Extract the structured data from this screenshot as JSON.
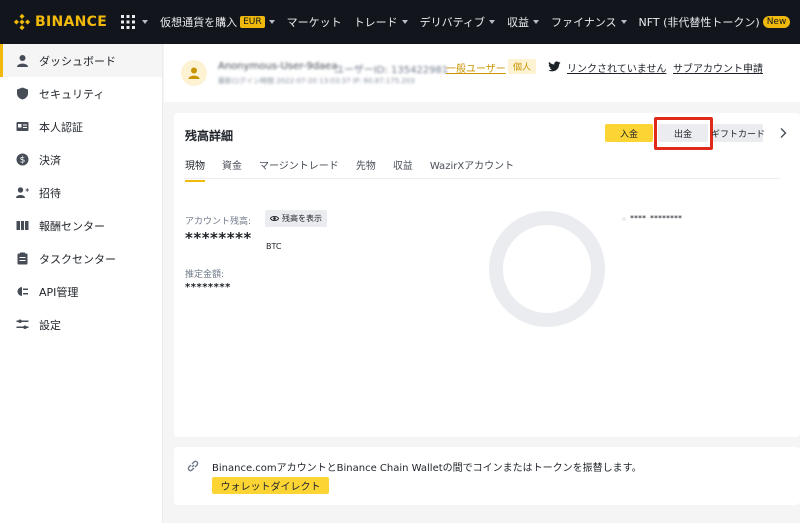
{
  "brand": {
    "name": "BINANCE",
    "color": "#f0b90b"
  },
  "topnav": {
    "items": [
      {
        "label": "仮想通貨を購入",
        "badge": "EUR",
        "has_caret": true
      },
      {
        "label": "マーケット",
        "badge": "",
        "has_caret": false
      },
      {
        "label": "トレード",
        "badge": "",
        "has_caret": true
      },
      {
        "label": "デリバティブ",
        "badge": "",
        "has_caret": true
      },
      {
        "label": "収益",
        "badge": "",
        "has_caret": true
      },
      {
        "label": "ファイナンス",
        "badge": "",
        "has_caret": true
      },
      {
        "label": "NFT (非代替性トークン)",
        "badge": "New",
        "has_caret": false
      }
    ]
  },
  "sidebar": {
    "items": [
      {
        "label": "ダッシュボード",
        "icon": "user-icon",
        "active": true
      },
      {
        "label": "セキュリティ",
        "icon": "shield-icon",
        "active": false
      },
      {
        "label": "本人認証",
        "icon": "id-card-icon",
        "active": false
      },
      {
        "label": "決済",
        "icon": "dollar-icon",
        "active": false
      },
      {
        "label": "招待",
        "icon": "user-plus-icon",
        "active": false
      },
      {
        "label": "報酬センター",
        "icon": "reward-icon",
        "active": false
      },
      {
        "label": "タスクセンター",
        "icon": "clipboard-icon",
        "active": false
      },
      {
        "label": "API管理",
        "icon": "api-icon",
        "active": false
      },
      {
        "label": "設定",
        "icon": "sliders-icon",
        "active": false
      }
    ]
  },
  "user": {
    "name": "Anonymous-User-9daea",
    "id": "ユーザーID: 135422981",
    "last_login": "最新ログイン時間 2022-07-20 13:03:37  IP: 60.87.175.203",
    "level": "一般ユーザー",
    "type": "個人",
    "twitter_link": "リンクされていません",
    "subaccount_link": "サブアカウント申請"
  },
  "balance": {
    "title": "残高詳細",
    "deposit_label": "入金",
    "withdraw_label": "出金",
    "gift_label": "ギフトカード",
    "tabs": [
      "現物",
      "資金",
      "マージントレード",
      "先物",
      "収益",
      "WazirXアカウント"
    ],
    "active_tab": 0,
    "account_label": "アカウント残高:",
    "show_balance_label": "残高を表示",
    "account_value": "********",
    "account_unit": "BTC",
    "estimate_label": "推定金額:",
    "estimate_value": "********",
    "legend_asset": "****",
    "legend_value": "********",
    "highlight_color": "#e02a1a"
  },
  "banner": {
    "text": "Binance.comアカウントとBinance Chain Walletの間でコインまたはトークンを振替します。",
    "button_label": "ウォレットダイレクト"
  },
  "colors": {
    "accent": "#f0b90b",
    "button_yellow": "#fcd535",
    "nav_bg": "#12161c"
  }
}
